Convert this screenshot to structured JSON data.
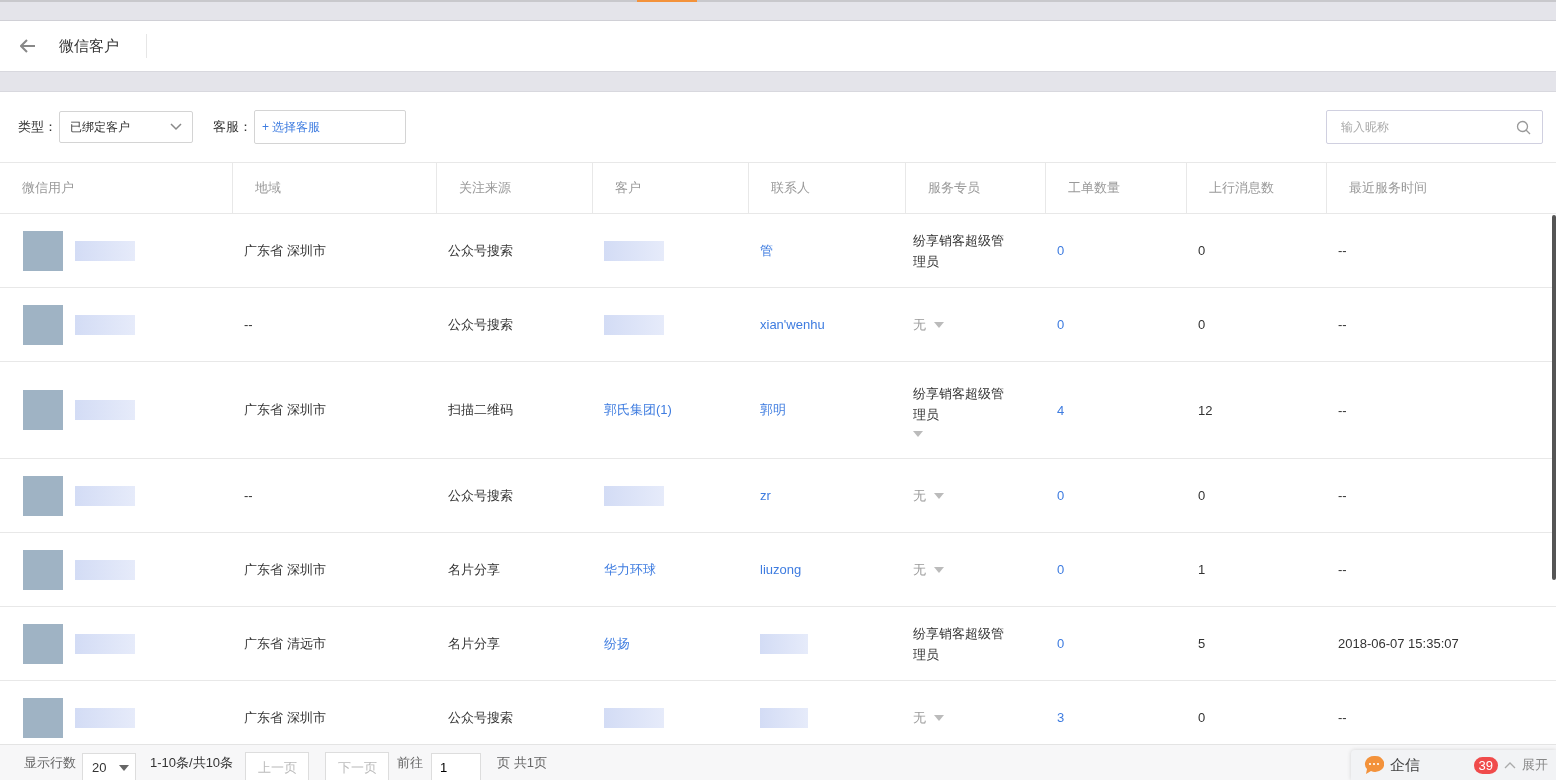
{
  "header": {
    "title": "微信客户"
  },
  "filters": {
    "type_label": "类型：",
    "type_value": "已绑定客户",
    "agent_label": "客服：",
    "agent_button": "+ 选择客服",
    "search": {
      "placeholder": "输入昵称"
    }
  },
  "table": {
    "columns": [
      "微信用户",
      "地域",
      "关注来源",
      "客户",
      "联系人",
      "服务专员",
      "工单数量",
      "上行消息数",
      "最近服务时间"
    ],
    "rows": [
      {
        "region": "广东省 深圳市",
        "source": "公众号搜索",
        "contact": "管",
        "agent": "纷享销客超级管理员",
        "assigned": true,
        "caret": false,
        "orders": "0",
        "messages": "0",
        "last_service": "--"
      },
      {
        "region": "--",
        "source": "公众号搜索",
        "contact": "xian'wenhu",
        "agent": "无",
        "assigned": false,
        "caret": true,
        "orders": "0",
        "messages": "0",
        "last_service": "--"
      },
      {
        "region": "广东省 深圳市",
        "source": "扫描二维码",
        "customer": "郭氏集团(1)",
        "contact": "郭明",
        "agent": "纷享销客超级管理员",
        "assigned": true,
        "caret": true,
        "orders": "4",
        "messages": "12",
        "last_service": "--"
      },
      {
        "region": "--",
        "source": "公众号搜索",
        "contact": "zr",
        "agent": "无",
        "assigned": false,
        "caret": true,
        "orders": "0",
        "messages": "0",
        "last_service": "--"
      },
      {
        "region": "广东省 深圳市",
        "source": "名片分享",
        "customer": "华力环球",
        "contact": "liuzong",
        "agent": "无",
        "assigned": false,
        "caret": true,
        "orders": "0",
        "messages": "1",
        "last_service": "--"
      },
      {
        "region": "广东省 清远市",
        "source": "名片分享",
        "customer": "纷扬",
        "agent": "纷享销客超级管理员",
        "assigned": true,
        "caret": false,
        "orders": "0",
        "messages": "5",
        "last_service": "2018-06-07 15:35:07"
      },
      {
        "region": "广东省 深圳市",
        "source": "公众号搜索",
        "agent": "无",
        "assigned": false,
        "caret": true,
        "orders": "3",
        "messages": "0",
        "last_service": "--"
      }
    ]
  },
  "pagination": {
    "rows_label": "显示行数",
    "page_size": "20",
    "range": "1-10条/共10条",
    "prev": {
      "label": "上一页",
      "disabled": true
    },
    "next": {
      "label": "下一页",
      "disabled": true
    },
    "goto_label": "前往",
    "page": "1",
    "total": "页 共1页"
  },
  "chat_widget": {
    "title": "企信",
    "badge": "39",
    "expand": "展开"
  }
}
